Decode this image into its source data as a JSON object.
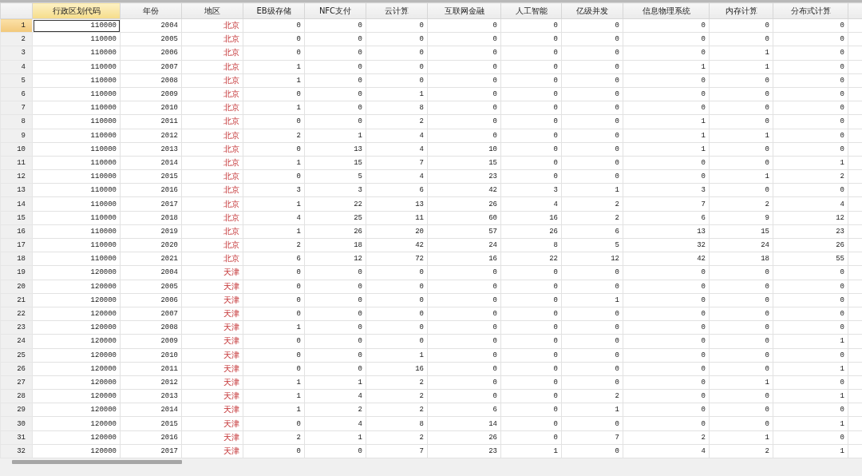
{
  "table": {
    "columns": [
      {
        "label": "行政区划代码",
        "kind": "numeric",
        "selected": true
      },
      {
        "label": "年份",
        "kind": "numeric",
        "selected": false
      },
      {
        "label": "地区",
        "kind": "string",
        "selected": false
      },
      {
        "label": "EB级存储",
        "kind": "numeric",
        "selected": false
      },
      {
        "label": "NFC支付",
        "kind": "numeric",
        "selected": false
      },
      {
        "label": "云计算",
        "kind": "numeric",
        "selected": false
      },
      {
        "label": "互联网金融",
        "kind": "numeric",
        "selected": false
      },
      {
        "label": "人工智能",
        "kind": "numeric",
        "selected": false
      },
      {
        "label": "亿级并发",
        "kind": "numeric",
        "selected": false
      },
      {
        "label": "信息物理系统",
        "kind": "numeric",
        "selected": false
      },
      {
        "label": "内存计算",
        "kind": "numeric",
        "selected": false
      },
      {
        "label": "分布式计算",
        "kind": "numeric",
        "selected": false
      }
    ],
    "rows": [
      {
        "number": "1",
        "selected": true,
        "cells": [
          "110000",
          "2004",
          "北京",
          "0",
          "0",
          "0",
          "0",
          "0",
          "0",
          "0",
          "0",
          "0"
        ]
      },
      {
        "number": "2",
        "selected": false,
        "cells": [
          "110000",
          "2005",
          "北京",
          "0",
          "0",
          "0",
          "0",
          "0",
          "0",
          "0",
          "0",
          "0"
        ]
      },
      {
        "number": "3",
        "selected": false,
        "cells": [
          "110000",
          "2006",
          "北京",
          "0",
          "0",
          "0",
          "0",
          "0",
          "0",
          "0",
          "1",
          "0"
        ]
      },
      {
        "number": "4",
        "selected": false,
        "cells": [
          "110000",
          "2007",
          "北京",
          "1",
          "0",
          "0",
          "0",
          "0",
          "0",
          "1",
          "1",
          "0"
        ]
      },
      {
        "number": "5",
        "selected": false,
        "cells": [
          "110000",
          "2008",
          "北京",
          "1",
          "0",
          "0",
          "0",
          "0",
          "0",
          "0",
          "0",
          "0"
        ]
      },
      {
        "number": "6",
        "selected": false,
        "cells": [
          "110000",
          "2009",
          "北京",
          "0",
          "0",
          "1",
          "0",
          "0",
          "0",
          "0",
          "0",
          "0"
        ]
      },
      {
        "number": "7",
        "selected": false,
        "cells": [
          "110000",
          "2010",
          "北京",
          "1",
          "0",
          "8",
          "0",
          "0",
          "0",
          "0",
          "0",
          "0"
        ]
      },
      {
        "number": "8",
        "selected": false,
        "cells": [
          "110000",
          "2011",
          "北京",
          "0",
          "0",
          "2",
          "0",
          "0",
          "0",
          "1",
          "0",
          "0"
        ]
      },
      {
        "number": "9",
        "selected": false,
        "cells": [
          "110000",
          "2012",
          "北京",
          "2",
          "1",
          "4",
          "0",
          "0",
          "0",
          "1",
          "1",
          "0"
        ]
      },
      {
        "number": "10",
        "selected": false,
        "cells": [
          "110000",
          "2013",
          "北京",
          "0",
          "13",
          "4",
          "10",
          "0",
          "0",
          "1",
          "0",
          "0"
        ]
      },
      {
        "number": "11",
        "selected": false,
        "cells": [
          "110000",
          "2014",
          "北京",
          "1",
          "15",
          "7",
          "15",
          "0",
          "0",
          "0",
          "0",
          "1"
        ]
      },
      {
        "number": "12",
        "selected": false,
        "cells": [
          "110000",
          "2015",
          "北京",
          "0",
          "5",
          "4",
          "23",
          "0",
          "0",
          "0",
          "1",
          "2"
        ]
      },
      {
        "number": "13",
        "selected": false,
        "cells": [
          "110000",
          "2016",
          "北京",
          "3",
          "3",
          "6",
          "42",
          "3",
          "1",
          "3",
          "0",
          "0"
        ]
      },
      {
        "number": "14",
        "selected": false,
        "cells": [
          "110000",
          "2017",
          "北京",
          "1",
          "22",
          "13",
          "26",
          "4",
          "2",
          "7",
          "2",
          "4"
        ]
      },
      {
        "number": "15",
        "selected": false,
        "cells": [
          "110000",
          "2018",
          "北京",
          "4",
          "25",
          "11",
          "60",
          "16",
          "2",
          "6",
          "9",
          "12"
        ]
      },
      {
        "number": "16",
        "selected": false,
        "cells": [
          "110000",
          "2019",
          "北京",
          "1",
          "26",
          "20",
          "57",
          "26",
          "6",
          "13",
          "15",
          "23"
        ]
      },
      {
        "number": "17",
        "selected": false,
        "cells": [
          "110000",
          "2020",
          "北京",
          "2",
          "18",
          "42",
          "24",
          "8",
          "5",
          "32",
          "24",
          "26"
        ]
      },
      {
        "number": "18",
        "selected": false,
        "cells": [
          "110000",
          "2021",
          "北京",
          "6",
          "12",
          "72",
          "16",
          "22",
          "12",
          "42",
          "18",
          "55"
        ]
      },
      {
        "number": "19",
        "selected": false,
        "cells": [
          "120000",
          "2004",
          "天津",
          "0",
          "0",
          "0",
          "0",
          "0",
          "0",
          "0",
          "0",
          "0"
        ]
      },
      {
        "number": "20",
        "selected": false,
        "cells": [
          "120000",
          "2005",
          "天津",
          "0",
          "0",
          "0",
          "0",
          "0",
          "0",
          "0",
          "0",
          "0"
        ]
      },
      {
        "number": "21",
        "selected": false,
        "cells": [
          "120000",
          "2006",
          "天津",
          "0",
          "0",
          "0",
          "0",
          "0",
          "1",
          "0",
          "0",
          "0"
        ]
      },
      {
        "number": "22",
        "selected": false,
        "cells": [
          "120000",
          "2007",
          "天津",
          "0",
          "0",
          "0",
          "0",
          "0",
          "0",
          "0",
          "0",
          "0"
        ]
      },
      {
        "number": "23",
        "selected": false,
        "cells": [
          "120000",
          "2008",
          "天津",
          "1",
          "0",
          "0",
          "0",
          "0",
          "0",
          "0",
          "0",
          "0"
        ]
      },
      {
        "number": "24",
        "selected": false,
        "cells": [
          "120000",
          "2009",
          "天津",
          "0",
          "0",
          "0",
          "0",
          "0",
          "0",
          "0",
          "0",
          "1"
        ]
      },
      {
        "number": "25",
        "selected": false,
        "cells": [
          "120000",
          "2010",
          "天津",
          "0",
          "0",
          "1",
          "0",
          "0",
          "0",
          "0",
          "0",
          "0"
        ]
      },
      {
        "number": "26",
        "selected": false,
        "cells": [
          "120000",
          "2011",
          "天津",
          "0",
          "0",
          "16",
          "0",
          "0",
          "0",
          "0",
          "0",
          "1"
        ]
      },
      {
        "number": "27",
        "selected": false,
        "cells": [
          "120000",
          "2012",
          "天津",
          "1",
          "1",
          "2",
          "0",
          "0",
          "0",
          "0",
          "1",
          "0"
        ]
      },
      {
        "number": "28",
        "selected": false,
        "cells": [
          "120000",
          "2013",
          "天津",
          "1",
          "4",
          "2",
          "0",
          "0",
          "2",
          "0",
          "0",
          "1"
        ]
      },
      {
        "number": "29",
        "selected": false,
        "cells": [
          "120000",
          "2014",
          "天津",
          "1",
          "2",
          "2",
          "6",
          "0",
          "1",
          "0",
          "0",
          "0"
        ]
      },
      {
        "number": "30",
        "selected": false,
        "cells": [
          "120000",
          "2015",
          "天津",
          "0",
          "4",
          "8",
          "14",
          "0",
          "0",
          "0",
          "0",
          "1"
        ]
      },
      {
        "number": "31",
        "selected": false,
        "cells": [
          "120000",
          "2016",
          "天津",
          "2",
          "1",
          "2",
          "26",
          "0",
          "7",
          "2",
          "1",
          "0"
        ]
      },
      {
        "number": "32",
        "selected": false,
        "cells": [
          "120000",
          "2017",
          "天津",
          "0",
          "0",
          "7",
          "23",
          "1",
          "0",
          "4",
          "2",
          "1"
        ]
      }
    ]
  }
}
